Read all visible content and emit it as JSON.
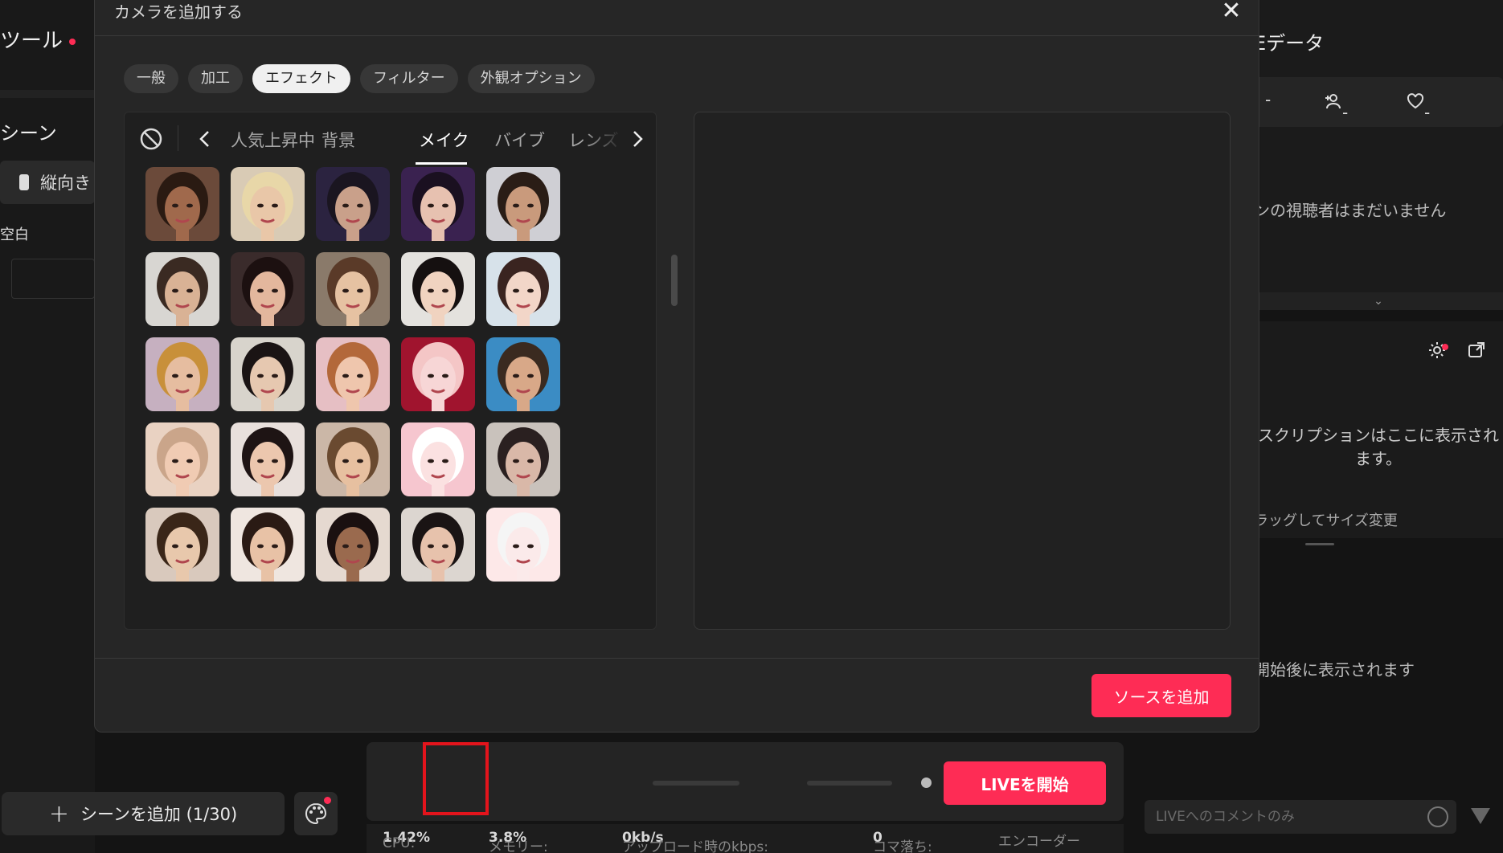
{
  "left": {
    "tools_label": "ツール",
    "scene_label": "シーン",
    "portrait_label": "縦向き",
    "blank_label": "空白",
    "add_scene_label": "シーンを追加 (1/30)"
  },
  "right": {
    "live_data_title": "Eデータ",
    "stat_1": "-",
    "stat_2": "-",
    "stat_3": "-",
    "no_viewers": "ンの視聴者はまだいません",
    "subscription_text": "スクリプションはここに表示されます。",
    "resize_hint": "ラッグしてサイズ変更",
    "after_start": "開始後に表示されます",
    "comment_placeholder": "LIVEへのコメントのみ"
  },
  "toolbar": {
    "live_button": "LIVEを開始",
    "cpu_label": "CPU:",
    "cpu_value": "1.42%",
    "memory_label": "メモリー:",
    "memory_value": "3.8%",
    "upload_label": "アップロード時のkbps:",
    "upload_value": "0kb/s",
    "dropped_label": "コマ落ち:",
    "dropped_value": "0",
    "encoder_label": "エンコーダー"
  },
  "modal": {
    "title": "カメラを追加する",
    "close": "✕",
    "tabs": [
      "一般",
      "加工",
      "エフェクト",
      "フィルター",
      "外観オプション"
    ],
    "active_tab": "エフェクト",
    "categories": [
      "人気上昇中",
      "背景",
      "メイク",
      "バイブ",
      "レンズ"
    ],
    "active_category": "メイク",
    "add_source_button": "ソースを追加"
  },
  "colors": {
    "accent": "#fe2c55",
    "highlight_box": "#e3141c"
  },
  "icons": {
    "settings": "gear-icon",
    "effects": "smiley-icon",
    "screen": "screen-share-icon",
    "adjust": "sliders-icon",
    "volume": "speaker-icon",
    "mic": "microphone-icon"
  }
}
